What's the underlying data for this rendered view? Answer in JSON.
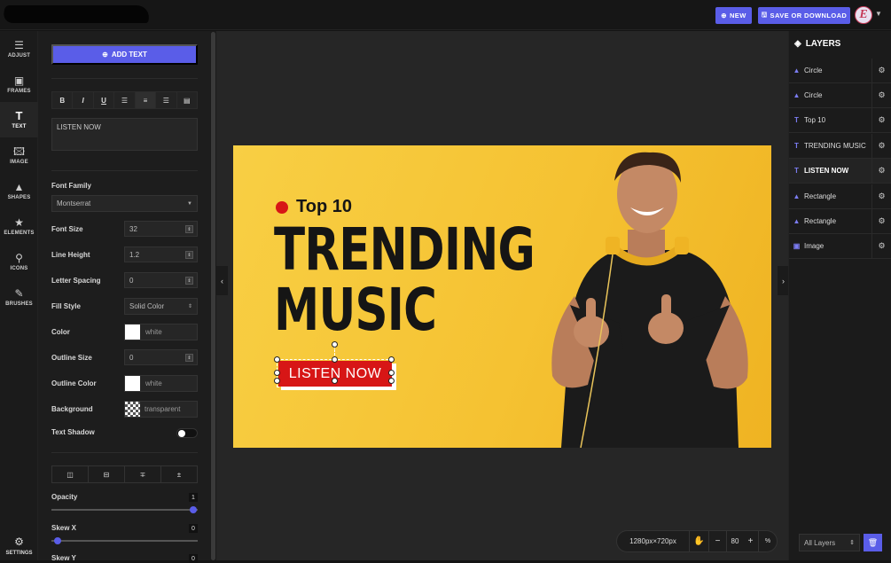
{
  "header": {
    "new_label": "NEW",
    "save_label": "SAVE OR DOWNLOAD",
    "avatar_letter": "E"
  },
  "nav": {
    "items": [
      {
        "label": "ADJUST",
        "icon": "sliders-icon"
      },
      {
        "label": "FRAMES",
        "icon": "frame-icon"
      },
      {
        "label": "TEXT",
        "icon": "text-icon"
      },
      {
        "label": "IMAGE",
        "icon": "image-icon"
      },
      {
        "label": "SHAPES",
        "icon": "shapes-icon"
      },
      {
        "label": "ELEMENTS",
        "icon": "star-icon"
      },
      {
        "label": "ICONS",
        "icon": "pin-icon"
      },
      {
        "label": "BRUSHES",
        "icon": "brush-icon"
      }
    ],
    "active": "TEXT",
    "settings_label": "SETTINGS"
  },
  "panel": {
    "add_text_label": "ADD TEXT",
    "format_buttons": [
      "B",
      "I",
      "U",
      "align-left",
      "align-center",
      "align-right",
      "align-justify"
    ],
    "text_value": "LISTEN NOW",
    "font_family_label": "Font Family",
    "font_family_value": "Montserrat",
    "font_size_label": "Font Size",
    "font_size_value": "32",
    "line_height_label": "Line Height",
    "line_height_value": "1.2",
    "letter_spacing_label": "Letter Spacing",
    "letter_spacing_value": "0",
    "fill_style_label": "Fill Style",
    "fill_style_value": "Solid Color",
    "color_label": "Color",
    "color_value": "white",
    "outline_size_label": "Outline Size",
    "outline_size_value": "0",
    "outline_color_label": "Outline Color",
    "outline_color_value": "white",
    "background_label": "Background",
    "background_value": "transparent",
    "text_shadow_label": "Text Shadow",
    "opacity_label": "Opacity",
    "opacity_value": "1",
    "opacity_level": 1,
    "skew_x_label": "Skew X",
    "skew_x_value": "0",
    "skew_x_level": 0,
    "skew_y_label": "Skew Y",
    "skew_y_value": "0"
  },
  "canvas": {
    "top_label": "Top 10",
    "headline_line1": "TRENDING",
    "headline_line2": "MUSIC",
    "button_text": "LISTEN NOW",
    "background_color": "#f5c232",
    "accent_color": "#d71616"
  },
  "layers": {
    "title": "LAYERS",
    "items": [
      {
        "name": "Circle",
        "type": "shape"
      },
      {
        "name": "Circle",
        "type": "shape"
      },
      {
        "name": "Top 10",
        "type": "text"
      },
      {
        "name": "TRENDING MUSIC",
        "type": "text"
      },
      {
        "name": "LISTEN NOW",
        "type": "text",
        "active": true
      },
      {
        "name": "Rectangle",
        "type": "shape"
      },
      {
        "name": "Rectangle",
        "type": "shape"
      },
      {
        "name": "Image",
        "type": "image"
      }
    ],
    "filter_value": "All Layers"
  },
  "statusbar": {
    "dimensions": "1280px×720px",
    "zoom": "80",
    "zoom_unit": "%"
  }
}
